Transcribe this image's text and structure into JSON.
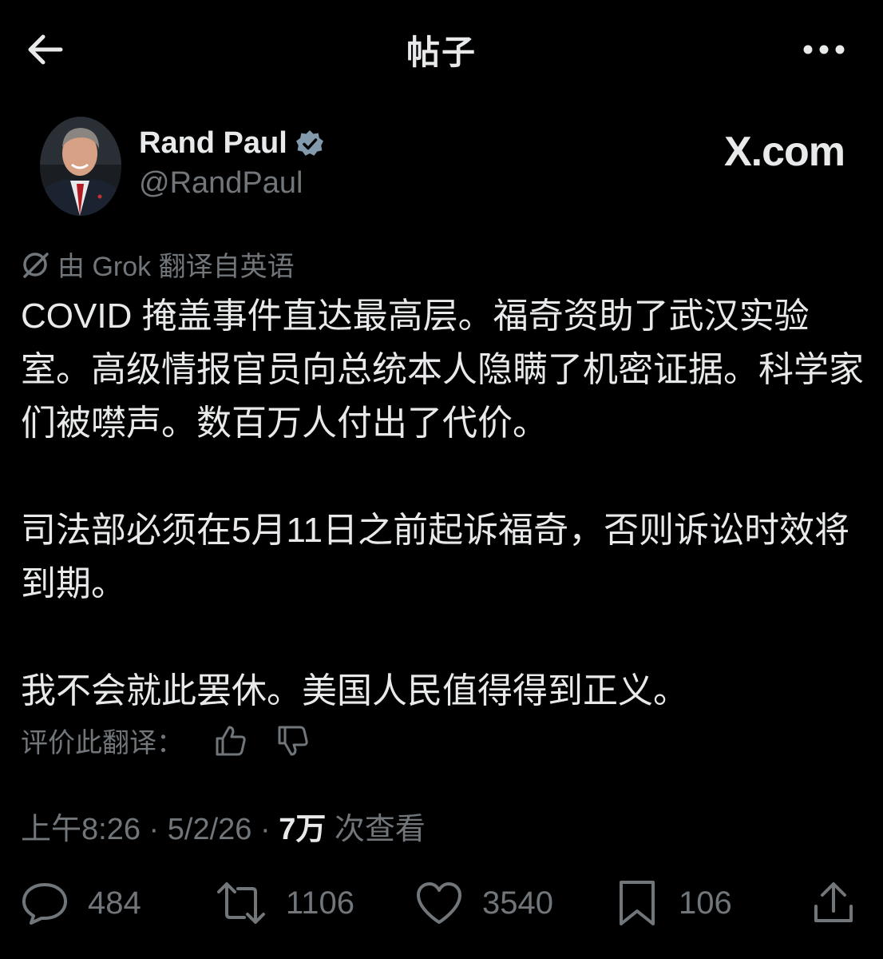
{
  "header": {
    "title": "帖子",
    "back_icon": "arrow-left-icon",
    "more_icon": "more-horizontal-icon"
  },
  "author": {
    "name": "Rand Paul",
    "handle": "@RandPaul",
    "verified": true
  },
  "watermark": "X.com",
  "translation_note": "由 Grok 翻译自英语",
  "post": {
    "paragraphs": [
      "COVID 掩盖事件直达最高层。福奇资助了武汉实验室。高级情报官员向总统本人隐瞒了机密证据。科学家们被噤声。数百万人付出了代价。",
      "司法部必须在5月11日之前起诉福奇，否则诉讼时效将到期。",
      "我不会就此罢休。美国人民值得得到正义。"
    ]
  },
  "rating": {
    "label": "评价此翻译："
  },
  "meta": {
    "time": "上午8:26",
    "sep1": " · ",
    "date": "5/2/26",
    "sep2": " · ",
    "views": "7万",
    "views_label": " 次查看"
  },
  "actions": {
    "replies": "484",
    "reposts": "1106",
    "likes": "3540",
    "bookmarks": "106"
  },
  "colors": {
    "background": "#000000",
    "text": "#e7e9ea",
    "secondary": "#71767b",
    "verified_badge": "#829aab"
  }
}
